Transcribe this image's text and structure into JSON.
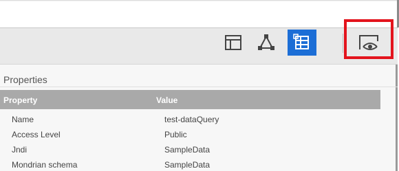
{
  "toolbar": {
    "buttons": [
      {
        "icon": "layout-icon",
        "active": false
      },
      {
        "icon": "schema-icon",
        "active": false
      },
      {
        "icon": "datasource-icon",
        "active": true
      },
      {
        "icon": "preview-icon",
        "active": false
      }
    ],
    "active_color": "#1c6ed6",
    "highlight_color": "#e3141d"
  },
  "properties": {
    "title": "Properties",
    "columns": {
      "property": "Property",
      "value": "Value"
    },
    "rows": [
      {
        "property": "Name",
        "value": "test-dataQuery"
      },
      {
        "property": "Access Level",
        "value": "Public"
      },
      {
        "property": "Jndi",
        "value": "SampleData"
      },
      {
        "property": "Mondrian schema",
        "value": "SampleData"
      }
    ]
  }
}
